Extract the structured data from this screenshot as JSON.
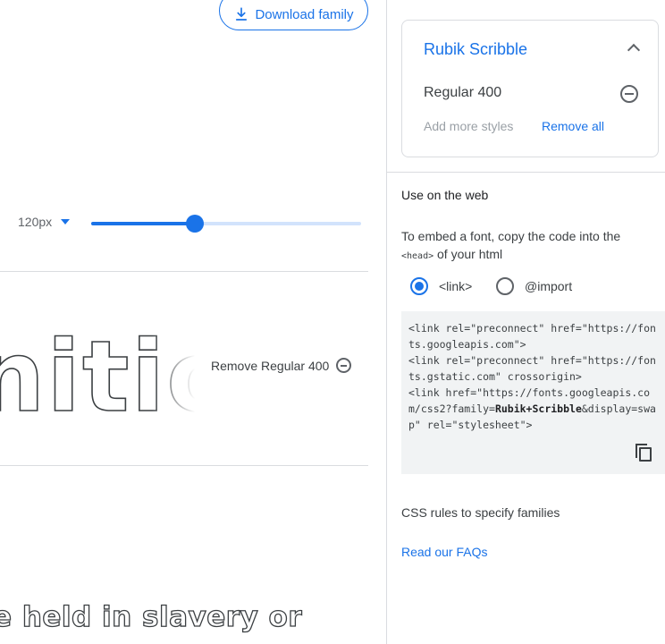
{
  "header": {
    "download_label": "Download family",
    "download_icon": "download-icon"
  },
  "controls": {
    "size_value": "120px",
    "slider_fraction": 0.385
  },
  "preview": {
    "sample_text": "nitio",
    "remove_label": "Remove Regular 400",
    "bottom_sample": "e held in slavery or"
  },
  "panel": {
    "family_name": "Rubik Scribble",
    "style_name": "Regular 400",
    "add_more": "Add more styles",
    "remove_all": "Remove all",
    "use_on_web": "Use on the web",
    "embed_desc_prefix": "To embed a font, copy the code into the",
    "embed_code_tag": "<head>",
    "embed_desc_suffix": "of your html",
    "radio_link": "<link>",
    "radio_import": "@import",
    "code_part1": "<link rel=\"preconnect\" href=\"https://fonts.googleapis.com\">\n<link rel=\"preconnect\" href=\"https://fonts.gstatic.com\" crossorigin>\n<link href=\"https://fonts.googleapis.com/css2?family=",
    "code_family": "Rubik+Scribble",
    "code_part2": "&display=swap\" rel=\"stylesheet\">",
    "css_rules": "CSS rules to specify families",
    "faqs": "Read our FAQs"
  },
  "colors": {
    "accent": "#1a73e8",
    "text": "#202124",
    "muted": "#5f6368",
    "code_bg": "#f1f3f4"
  }
}
